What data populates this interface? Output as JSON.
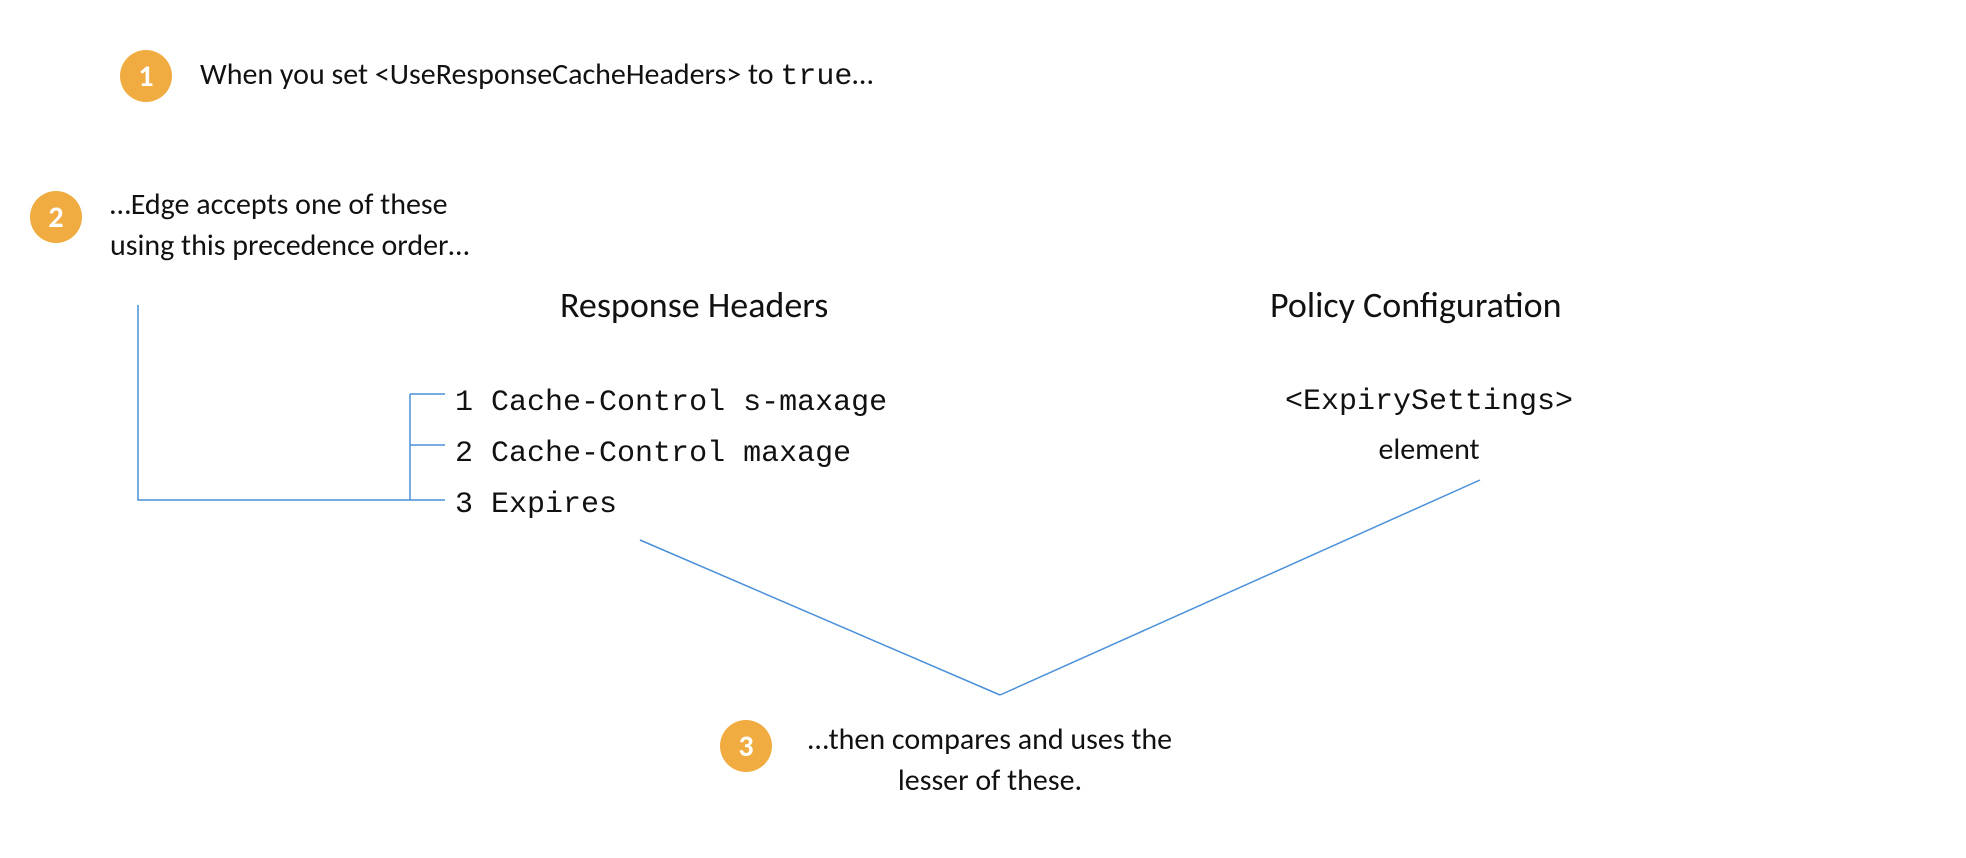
{
  "steps": {
    "s1": {
      "num": "1",
      "prefix": "When you set ",
      "tag": "<UseResponseCacheHeaders>",
      "mid": " to ",
      "val": "true",
      "suffix": "…"
    },
    "s2": {
      "num": "2",
      "text": "…Edge accepts one of these using this precedence order…"
    },
    "s3": {
      "num": "3",
      "text": "…then compares and uses the lesser of these."
    }
  },
  "headings": {
    "response": "Response Headers",
    "policy": "Policy Configuration"
  },
  "headers_list": {
    "i1_num": "1",
    "i1_text": "Cache-Control s-maxage",
    "i2_num": "2",
    "i2_text": "Cache-Control maxage",
    "i3_num": "3",
    "i3_text": "Expires"
  },
  "policy": {
    "tag": "<ExpirySettings>",
    "label": "element"
  }
}
